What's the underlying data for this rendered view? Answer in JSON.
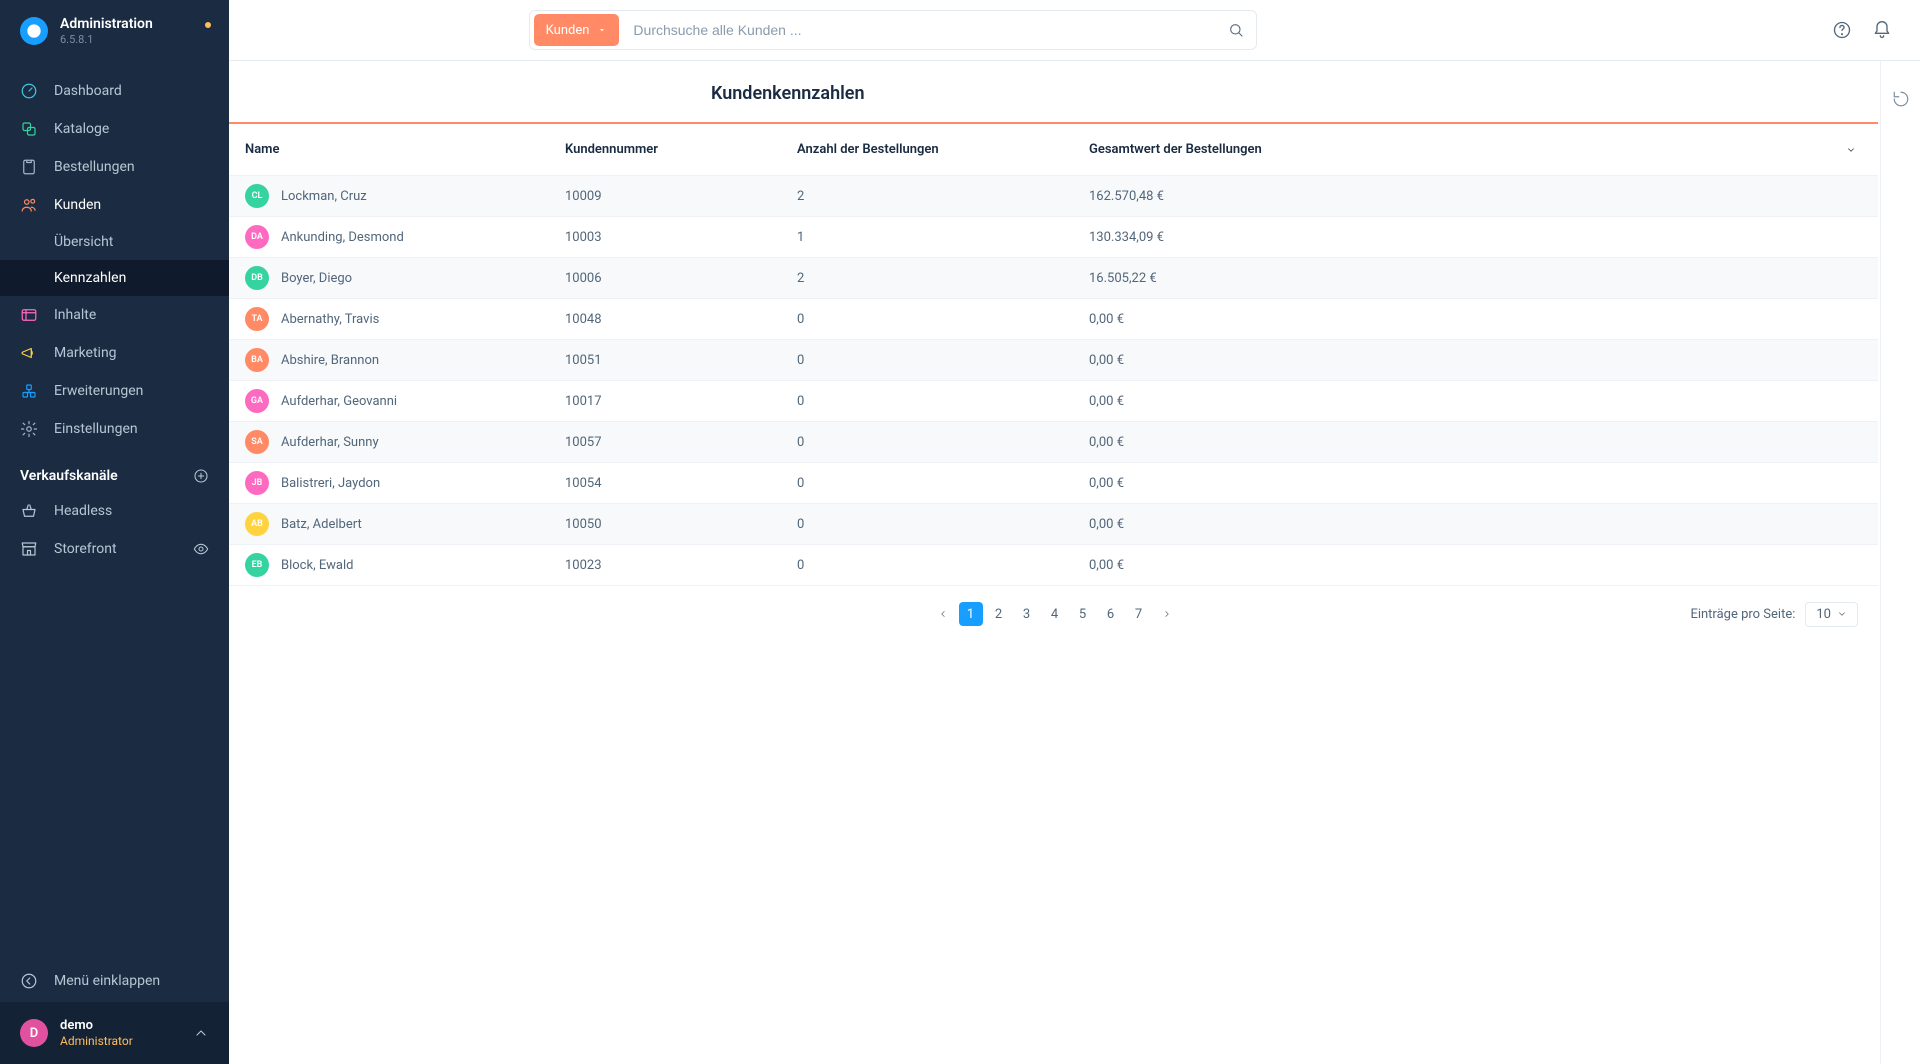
{
  "header": {
    "app_title": "Administration",
    "app_version": "6.5.8.1"
  },
  "sidebar": {
    "items": [
      {
        "label": "Dashboard",
        "icon": "gauge-icon",
        "color": "#40c8e0"
      },
      {
        "label": "Kataloge",
        "icon": "catalog-icon",
        "color": "#34d39f"
      },
      {
        "label": "Bestellungen",
        "icon": "orders-icon",
        "color": "#a6b6c9"
      },
      {
        "label": "Kunden",
        "icon": "customers-icon",
        "color": "#ff8a65",
        "active": true
      },
      {
        "label": "Inhalte",
        "icon": "content-icon",
        "color": "#ff6ac1"
      },
      {
        "label": "Marketing",
        "icon": "megaphone-icon",
        "color": "#ffd23f"
      },
      {
        "label": "Erweiterungen",
        "icon": "plugin-icon",
        "color": "#189eff"
      },
      {
        "label": "Einstellungen",
        "icon": "gear-icon",
        "color": "#a6b6c9"
      }
    ],
    "sub_customers": [
      {
        "label": "Übersicht"
      },
      {
        "label": "Kennzahlen",
        "active": true
      }
    ],
    "channels_title": "Verkaufskanäle",
    "channels": [
      {
        "label": "Headless",
        "icon": "basket-icon"
      },
      {
        "label": "Storefront",
        "icon": "storefront-icon",
        "has_eye": true
      }
    ],
    "collapse_label": "Menü einklappen",
    "user": {
      "initial": "D",
      "name": "demo",
      "role": "Administrator"
    }
  },
  "search": {
    "scope_label": "Kunden",
    "placeholder": "Durchsuche alle Kunden ..."
  },
  "page": {
    "title": "Kundenkennzahlen"
  },
  "table": {
    "columns": [
      "Name",
      "Kundennummer",
      "Anzahl der Bestellungen",
      "Gesamtwert der Bestellungen"
    ],
    "rows": [
      {
        "initials": "CL",
        "color": "#34d39f",
        "name": "Lockman, Cruz",
        "number": "10009",
        "orders": "2",
        "total": "162.570,48 €"
      },
      {
        "initials": "DA",
        "color": "#ff6ac1",
        "name": "Ankunding, Desmond",
        "number": "10003",
        "orders": "1",
        "total": "130.334,09 €"
      },
      {
        "initials": "DB",
        "color": "#34d39f",
        "name": "Boyer, Diego",
        "number": "10006",
        "orders": "2",
        "total": "16.505,22 €"
      },
      {
        "initials": "TA",
        "color": "#ff8a65",
        "name": "Abernathy, Travis",
        "number": "10048",
        "orders": "0",
        "total": "0,00 €"
      },
      {
        "initials": "BA",
        "color": "#ff8a65",
        "name": "Abshire, Brannon",
        "number": "10051",
        "orders": "0",
        "total": "0,00 €"
      },
      {
        "initials": "GA",
        "color": "#ff6ac1",
        "name": "Aufderhar, Geovanni",
        "number": "10017",
        "orders": "0",
        "total": "0,00 €"
      },
      {
        "initials": "SA",
        "color": "#ff8a65",
        "name": "Aufderhar, Sunny",
        "number": "10057",
        "orders": "0",
        "total": "0,00 €"
      },
      {
        "initials": "JB",
        "color": "#ff6ac1",
        "name": "Balistreri, Jaydon",
        "number": "10054",
        "orders": "0",
        "total": "0,00 €"
      },
      {
        "initials": "AB",
        "color": "#ffd23f",
        "name": "Batz, Adelbert",
        "number": "10050",
        "orders": "0",
        "total": "0,00 €"
      },
      {
        "initials": "EB",
        "color": "#34d39f",
        "name": "Block, Ewald",
        "number": "10023",
        "orders": "0",
        "total": "0,00 €"
      }
    ]
  },
  "pagination": {
    "pages": [
      "1",
      "2",
      "3",
      "4",
      "5",
      "6",
      "7"
    ],
    "active": "1",
    "per_page_label": "Einträge pro Seite:",
    "per_page_value": "10"
  }
}
